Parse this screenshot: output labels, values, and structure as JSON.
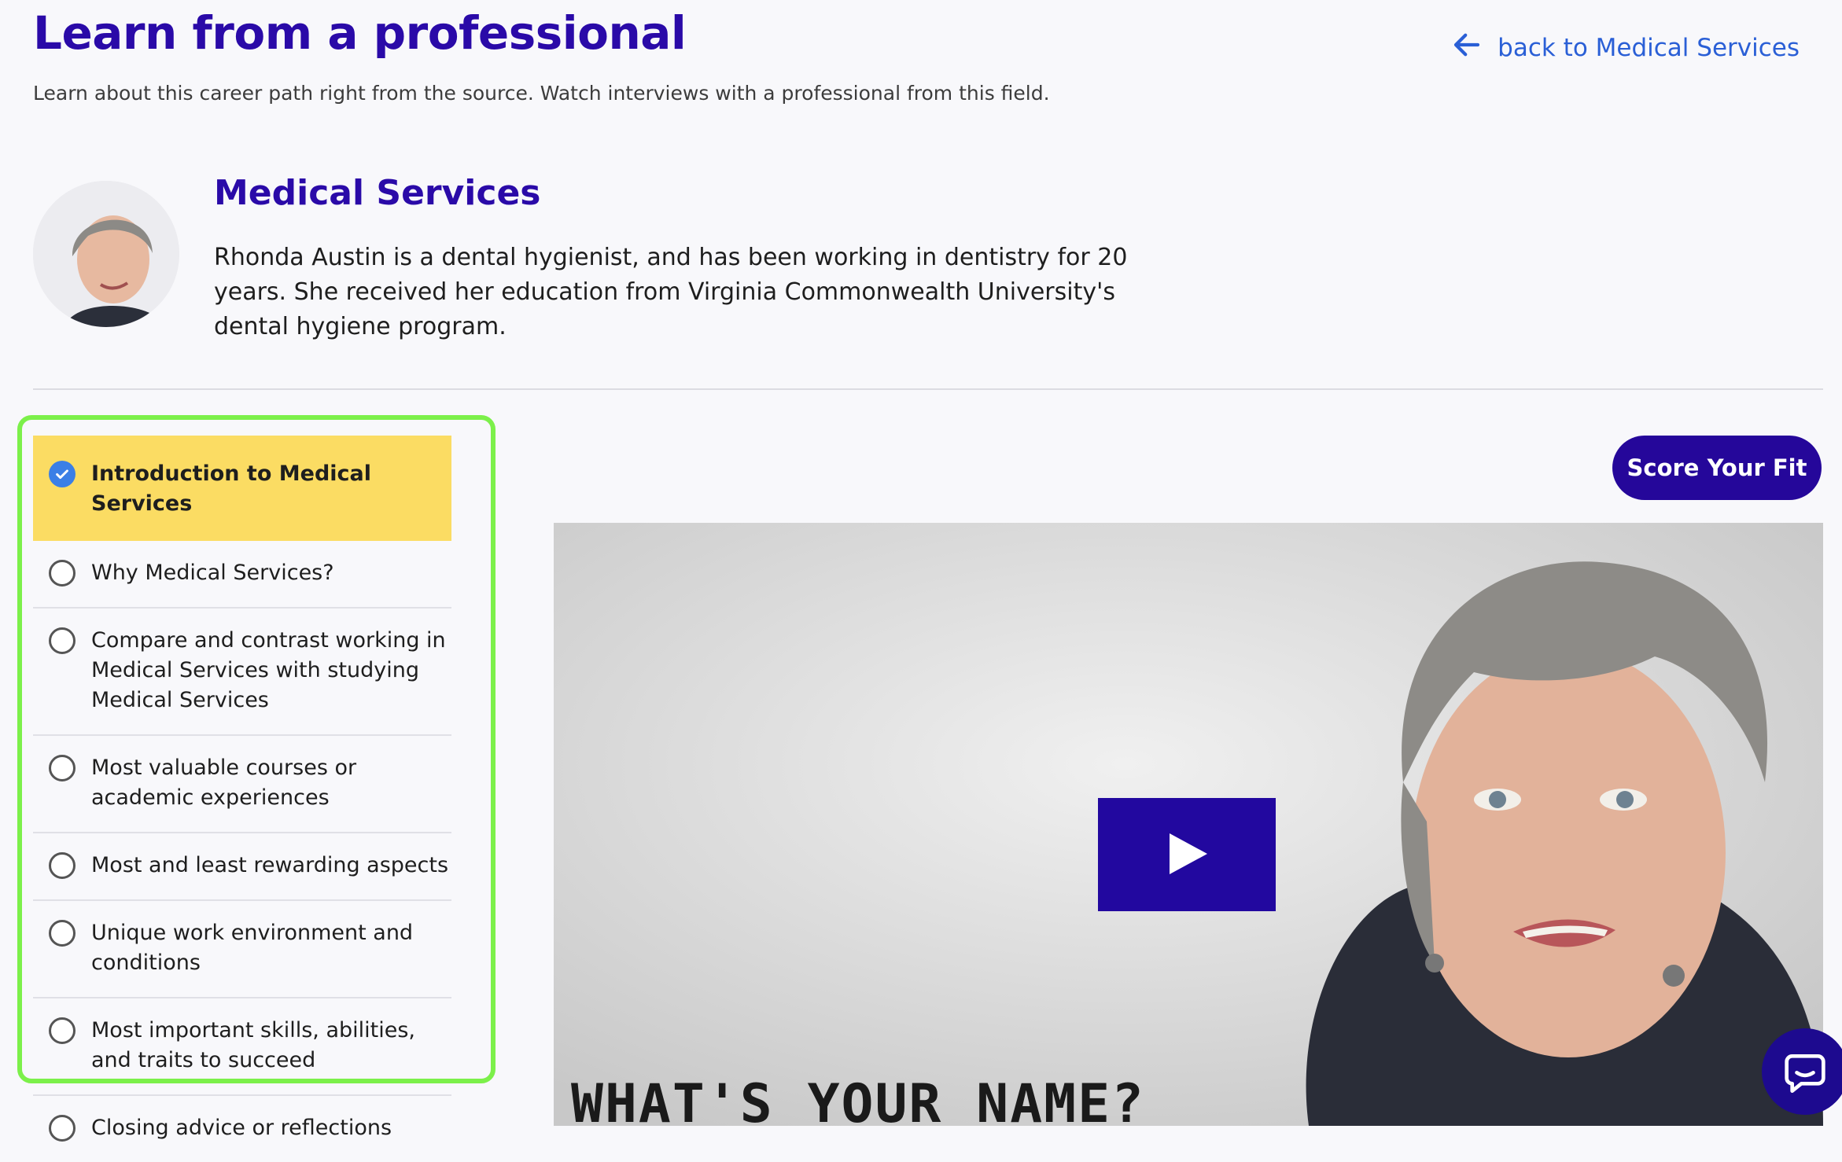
{
  "header": {
    "title": "Learn from a professional",
    "subtitle": "Learn about this career path right from the source. Watch interviews with a professional from this field.",
    "back_link": "back to Medical Services"
  },
  "professional": {
    "field": "Medical Services",
    "description": "Rhonda Austin is a dental hygienist, and has been working in dentistry for 20 years. She received her education from Virginia Commonwealth University's dental hygiene program."
  },
  "chapters": [
    {
      "label": "Introduction to Medical Services",
      "checked": true
    },
    {
      "label": "Why Medical Services?",
      "checked": false
    },
    {
      "label": "Compare and contrast working in Medical Services with studying Medical Services",
      "checked": false
    },
    {
      "label": "Most valuable courses or academic experiences",
      "checked": false
    },
    {
      "label": "Most and least rewarding aspects",
      "checked": false
    },
    {
      "label": "Unique work environment and conditions",
      "checked": false
    },
    {
      "label": "Most important skills, abilities, and traits to succeed",
      "checked": false
    },
    {
      "label": "Closing advice or reflections",
      "checked": false
    }
  ],
  "actions": {
    "score_fit": "Score Your Fit"
  },
  "video": {
    "caption": "WHAT'S YOUR NAME?"
  },
  "icons": {
    "back": "arrow-left-icon",
    "check": "check-icon",
    "play": "play-icon",
    "chat": "chat-icon"
  },
  "colors": {
    "brand": "#2a0aa8",
    "link": "#2a5fd6",
    "active_item": "#fbdc63",
    "highlight_border": "#7cf04a",
    "check": "#3b7fe6"
  }
}
